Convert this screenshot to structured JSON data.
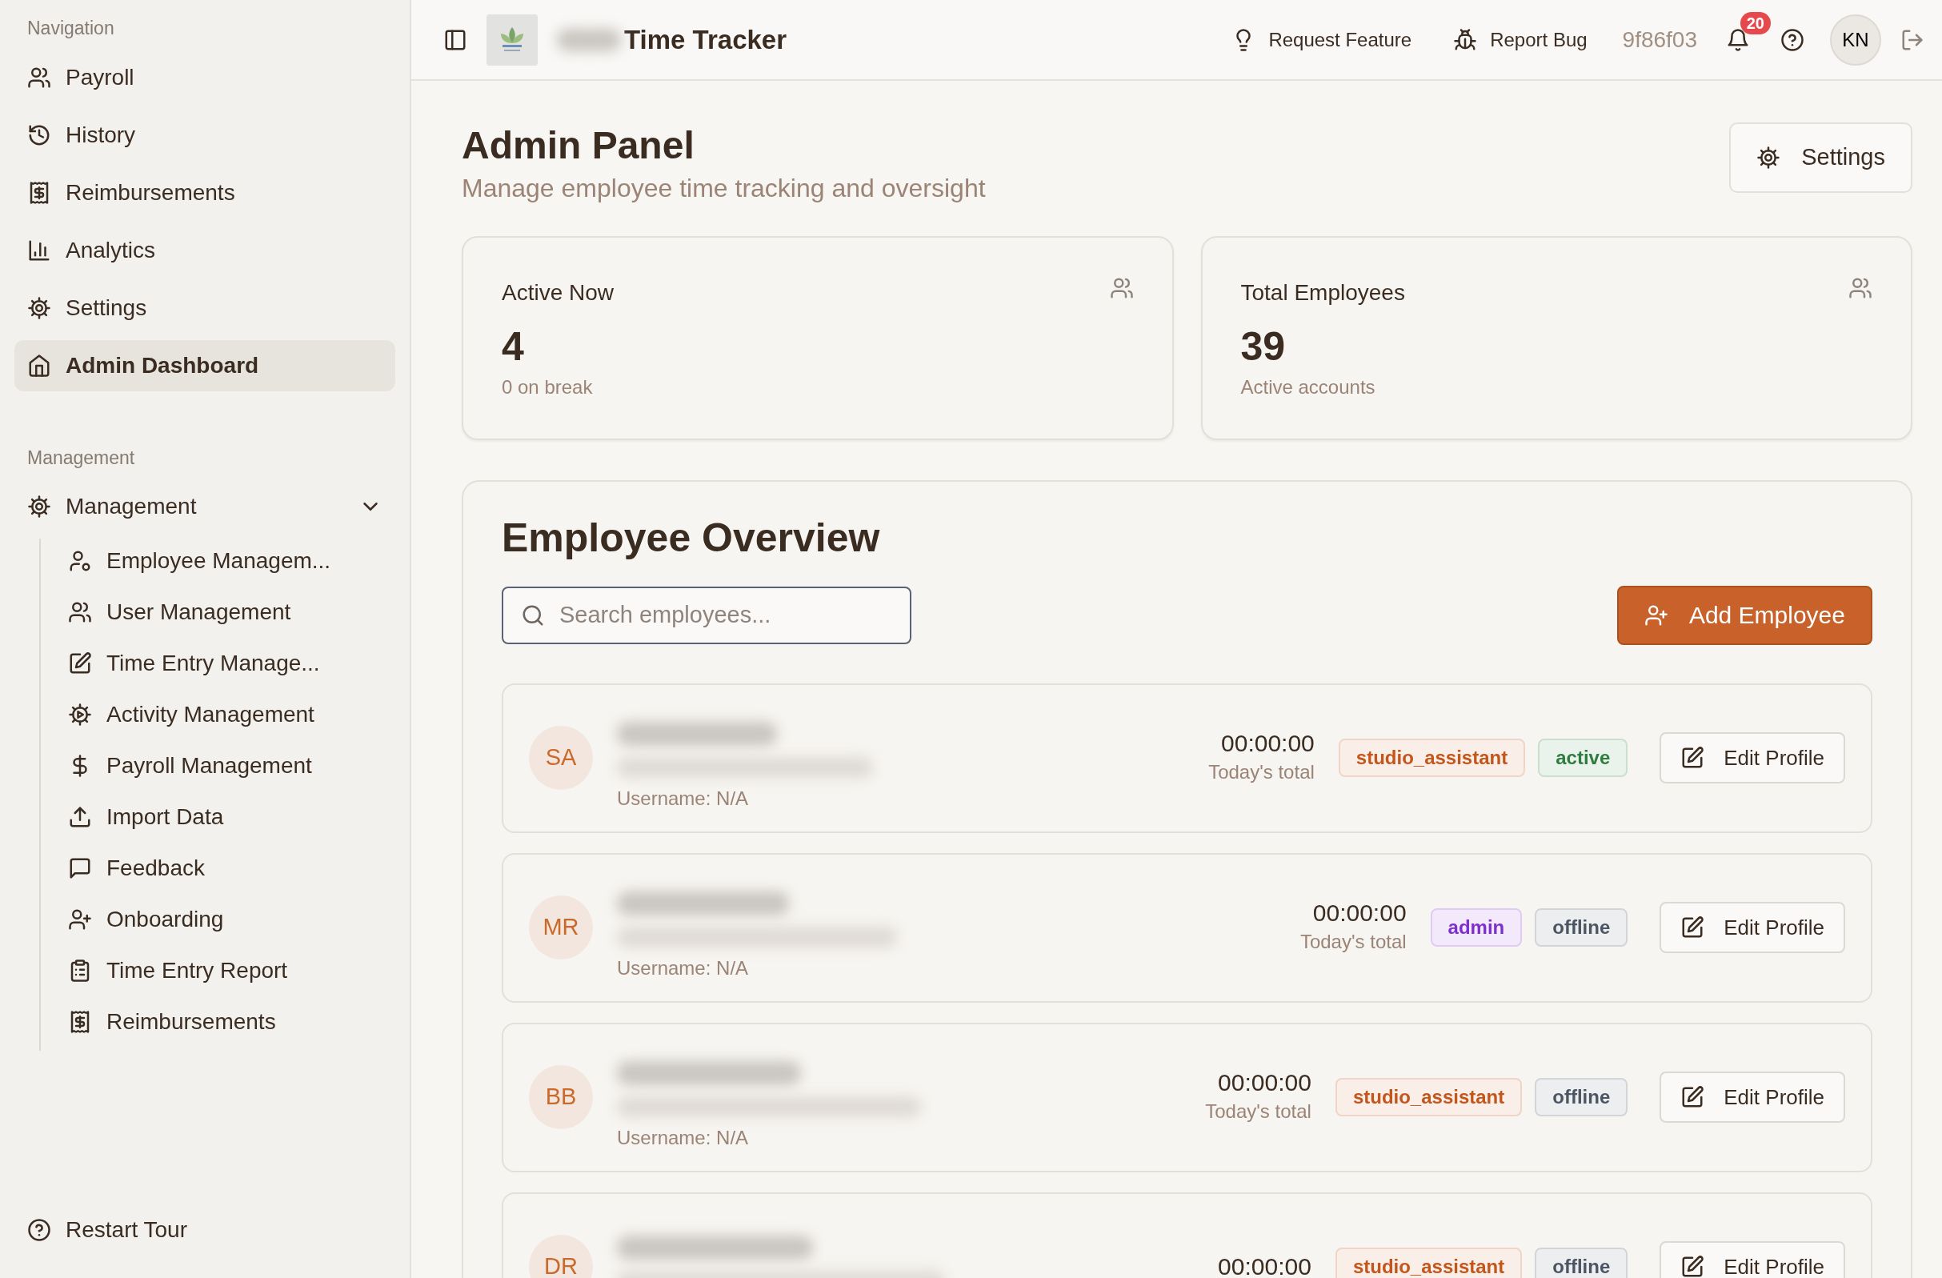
{
  "sidebar": {
    "sections": [
      {
        "label": "Navigation",
        "items": [
          {
            "label": "Payroll",
            "selected": false
          },
          {
            "label": "History",
            "selected": false
          },
          {
            "label": "Reimbursements",
            "selected": false
          },
          {
            "label": "Analytics",
            "selected": false
          },
          {
            "label": "Settings",
            "selected": false
          },
          {
            "label": "Admin Dashboard",
            "selected": true
          }
        ]
      },
      {
        "label": "Management",
        "items": [
          {
            "label": "Management",
            "selected": false,
            "expanded": true,
            "children": [
              {
                "label": "Employee Managem...",
                "selected": false
              },
              {
                "label": "User Management",
                "selected": false
              },
              {
                "label": "Time Entry Manage...",
                "selected": false
              },
              {
                "label": "Activity Management",
                "selected": false
              },
              {
                "label": "Payroll Management",
                "selected": false
              },
              {
                "label": "Import Data",
                "selected": false
              },
              {
                "label": "Feedback",
                "selected": false
              },
              {
                "label": "Onboarding",
                "selected": false
              },
              {
                "label": "Time Entry Report",
                "selected": false
              },
              {
                "label": "Reimbursements",
                "selected": false
              }
            ]
          }
        ]
      }
    ],
    "footer": "Restart Tour"
  },
  "header": {
    "app_title": "Time Tracker",
    "actions": [
      "Request Feature",
      "Report Bug"
    ],
    "version": "9f86f03",
    "notification_count": "20",
    "avatar": "KN"
  },
  "page": {
    "title": "Admin Panel",
    "subtitle": "Manage employee time tracking and oversight",
    "settings_button": "Settings"
  },
  "stats": [
    {
      "label": "Active Now",
      "value": "4",
      "note": "0 on break"
    },
    {
      "label": "Total Employees",
      "value": "39",
      "note": "Active accounts"
    }
  ],
  "overview": {
    "title": "Employee Overview",
    "search": {
      "placeholder": "Search employees..."
    },
    "add_button": "Add Employee",
    "employees": [
      {
        "initials": "SA",
        "username": "Username: N/A",
        "time": "00:00:00",
        "time_label": "Today's total",
        "role": {
          "label": "studio_assistant",
          "color": "#c2561b"
        },
        "status": {
          "label": "active",
          "color": "#2f7d3e"
        },
        "action": "Edit Profile"
      },
      {
        "initials": "MR",
        "username": "Username: N/A",
        "time": "00:00:00",
        "time_label": "Today's total",
        "role": {
          "label": "admin",
          "color": "#7e2fd0"
        },
        "status": {
          "label": "offline",
          "color": "#4b5563"
        },
        "action": "Edit Profile"
      },
      {
        "initials": "BB",
        "username": "Username: N/A",
        "time": "00:00:00",
        "time_label": "Today's total",
        "role": {
          "label": "studio_assistant",
          "color": "#c2561b"
        },
        "status": {
          "label": "offline",
          "color": "#4b5563"
        },
        "action": "Edit Profile"
      },
      {
        "initials": "DR",
        "time": "00:00:00",
        "role": {
          "label": "studio_assistant",
          "color": "#c2561b"
        },
        "status": {
          "label": "offline",
          "color": "#4b5563"
        },
        "action": "Edit Profile"
      }
    ]
  }
}
